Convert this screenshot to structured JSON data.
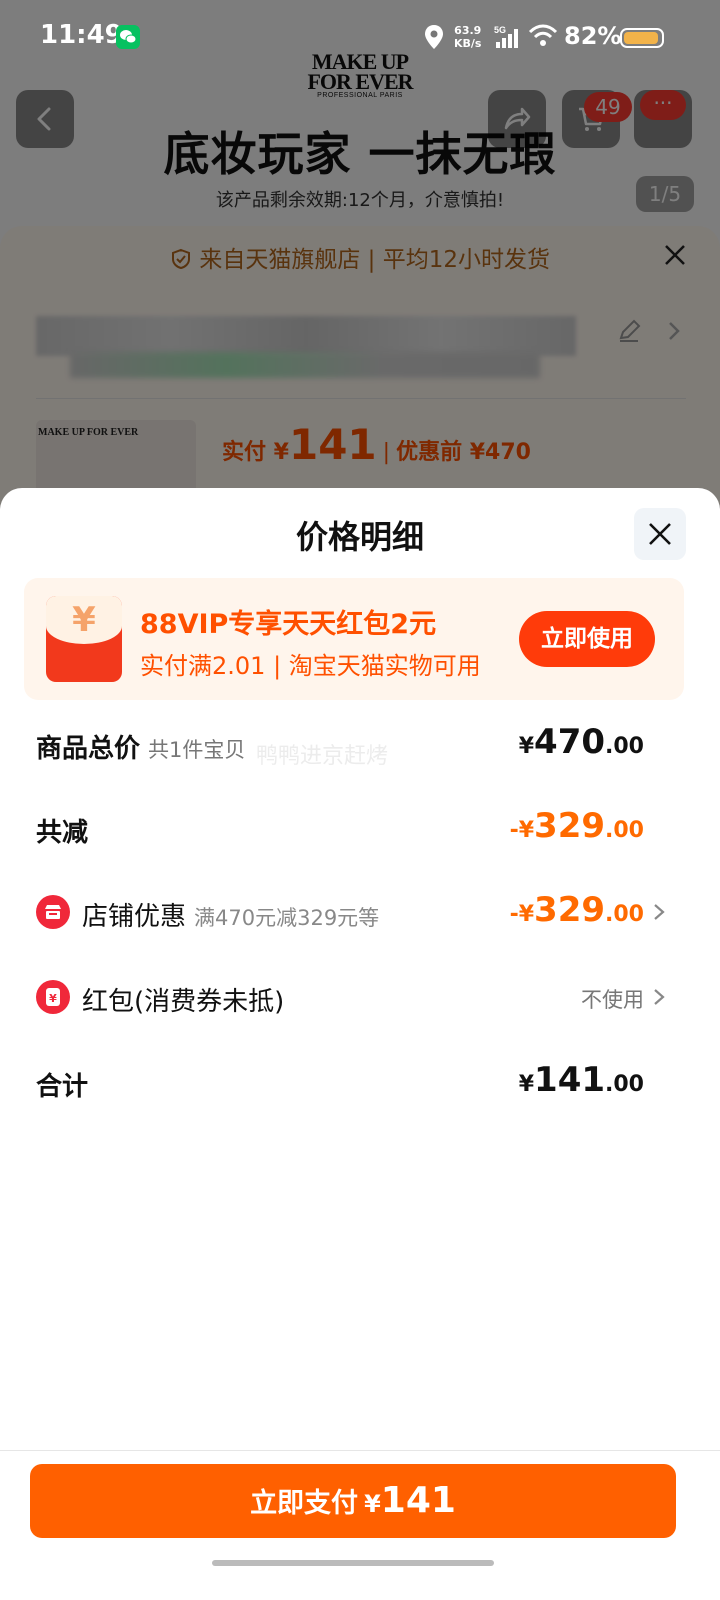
{
  "status_bar": {
    "time": "11:49",
    "net_speed_value": "63.9",
    "net_speed_unit": "KB/s",
    "network": "5G",
    "battery": "82%"
  },
  "background": {
    "brand": "MAKE UP FOR EVER",
    "brand_sub": "PROFESSIONAL PARIS",
    "hero_title": "底妆玩家 一抹无瑕",
    "hero_subtitle": "该产品剩余效期:12个月，介意慎拍!",
    "image_pager": "1/5",
    "cart_count": "49",
    "notice": "来自天猫旗舰店 | 平均12小时发货",
    "product_price_label": "实付 ¥",
    "product_price_value": "141",
    "product_original_price": "优惠前 ¥470"
  },
  "sheet": {
    "title": "价格明细",
    "promo": {
      "title": "88VIP专享天天红包2元",
      "subtitle": "实付满2.01 | 淘宝天猫实物可用",
      "button": "立即使用"
    },
    "watermark": "鸭鸭进京赶烤",
    "rows": [
      {
        "label": "商品总价",
        "note": "共1件宝贝",
        "currency": "¥",
        "integer": "470",
        "decimal": ".00"
      },
      {
        "label": "共减",
        "currency": "-¥",
        "integer": "329",
        "decimal": ".00"
      },
      {
        "label": "店铺优惠",
        "note": "满470元减329元等",
        "currency": "-¥",
        "integer": "329",
        "decimal": ".00"
      },
      {
        "label": "红包(消费券未抵)",
        "value": "不使用"
      },
      {
        "label": "合计",
        "currency": "¥",
        "integer": "141",
        "decimal": ".00"
      }
    ],
    "pay_button": {
      "label": "立即支付",
      "currency": "¥",
      "value": "141"
    }
  },
  "colors": {
    "accent_orange": "#ff6000",
    "promo_text": "#ff5000",
    "discount_red": "#f0283a"
  }
}
